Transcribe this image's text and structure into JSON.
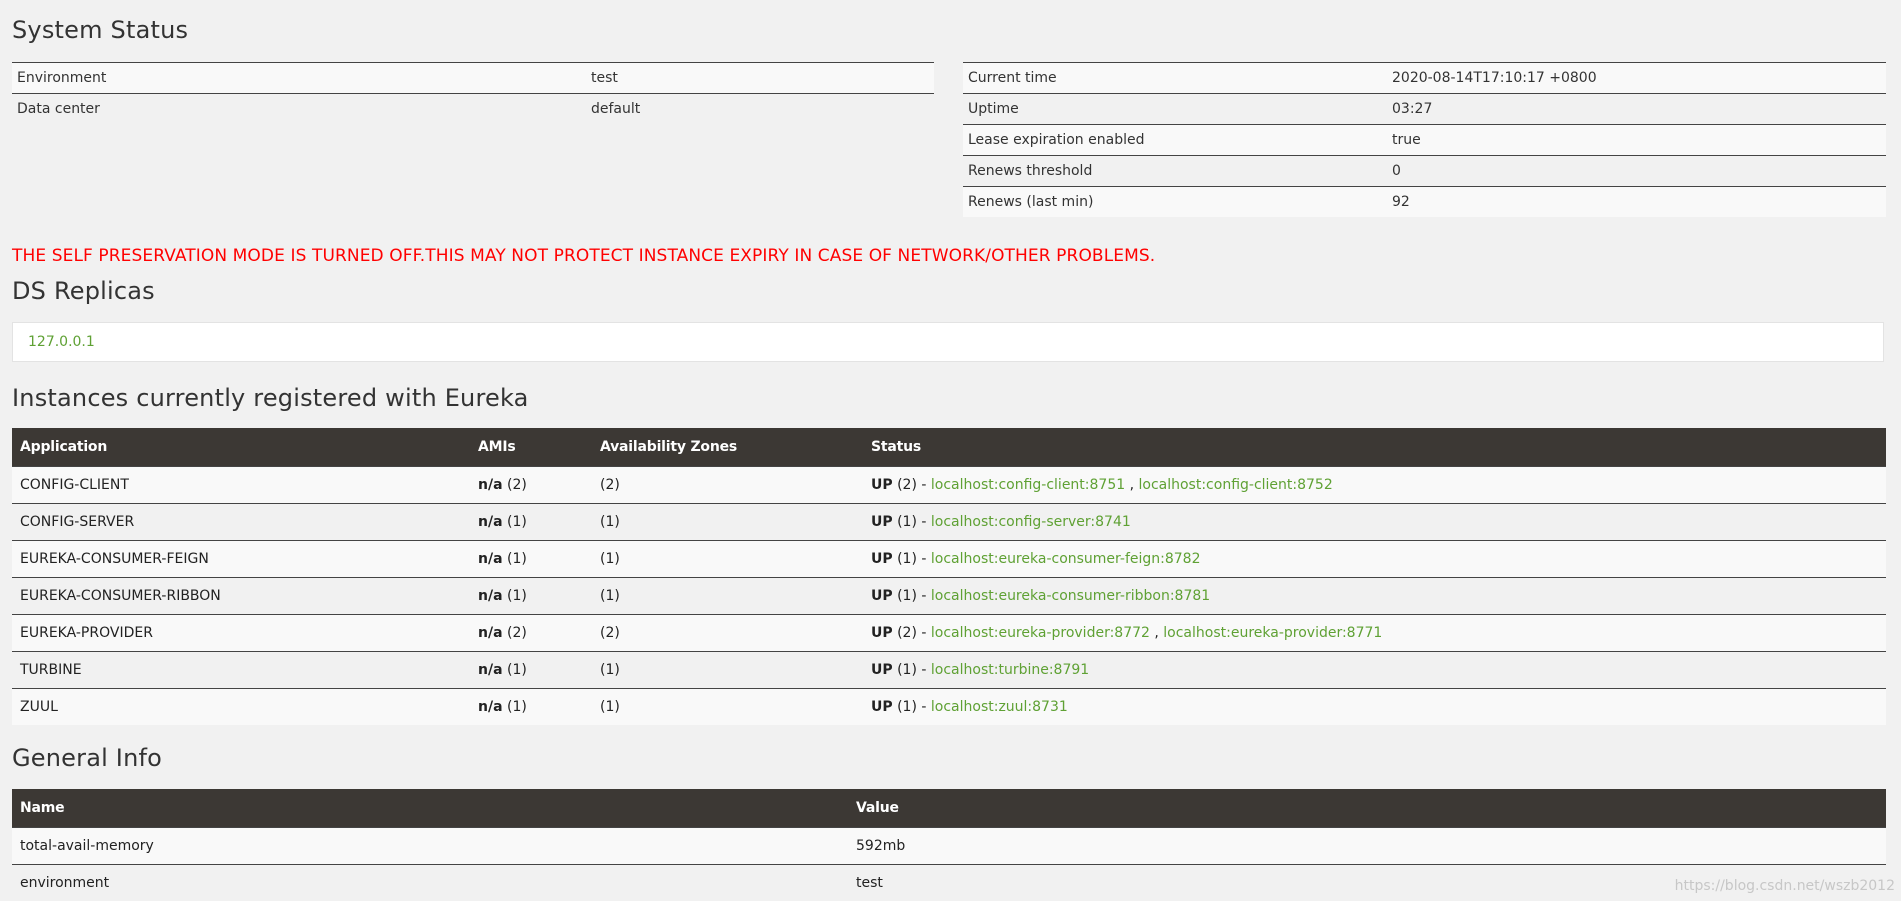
{
  "system_status": {
    "title": "System Status",
    "left": [
      {
        "key": "Environment",
        "value": "test"
      },
      {
        "key": "Data center",
        "value": "default"
      }
    ],
    "right": [
      {
        "key": "Current time",
        "value": "2020-08-14T17:10:17 +0800"
      },
      {
        "key": "Uptime",
        "value": "03:27"
      },
      {
        "key": "Lease expiration enabled",
        "value": "true"
      },
      {
        "key": "Renews threshold",
        "value": "0"
      },
      {
        "key": "Renews (last min)",
        "value": "92"
      }
    ]
  },
  "warning": "THE SELF PRESERVATION MODE IS TURNED OFF.THIS MAY NOT PROTECT INSTANCE EXPIRY IN CASE OF NETWORK/OTHER PROBLEMS.",
  "ds_replicas": {
    "title": "DS Replicas",
    "replica": "127.0.0.1"
  },
  "instances": {
    "title": "Instances currently registered with Eureka",
    "headers": [
      "Application",
      "AMIs",
      "Availability Zones",
      "Status"
    ],
    "rows": [
      {
        "app": "CONFIG-CLIENT",
        "ami": "n/a",
        "ami_count": "(2)",
        "zones": "(2)",
        "status": "UP",
        "status_count": "(2) -",
        "links": [
          "localhost:config-client:8751",
          "localhost:config-client:8752"
        ]
      },
      {
        "app": "CONFIG-SERVER",
        "ami": "n/a",
        "ami_count": "(1)",
        "zones": "(1)",
        "status": "UP",
        "status_count": "(1) -",
        "links": [
          "localhost:config-server:8741"
        ]
      },
      {
        "app": "EUREKA-CONSUMER-FEIGN",
        "ami": "n/a",
        "ami_count": "(1)",
        "zones": "(1)",
        "status": "UP",
        "status_count": "(1) -",
        "links": [
          "localhost:eureka-consumer-feign:8782"
        ]
      },
      {
        "app": "EUREKA-CONSUMER-RIBBON",
        "ami": "n/a",
        "ami_count": "(1)",
        "zones": "(1)",
        "status": "UP",
        "status_count": "(1) -",
        "links": [
          "localhost:eureka-consumer-ribbon:8781"
        ]
      },
      {
        "app": "EUREKA-PROVIDER",
        "ami": "n/a",
        "ami_count": "(2)",
        "zones": "(2)",
        "status": "UP",
        "status_count": "(2) -",
        "links": [
          "localhost:eureka-provider:8772",
          "localhost:eureka-provider:8771"
        ]
      },
      {
        "app": "TURBINE",
        "ami": "n/a",
        "ami_count": "(1)",
        "zones": "(1)",
        "status": "UP",
        "status_count": "(1) -",
        "links": [
          "localhost:turbine:8791"
        ]
      },
      {
        "app": "ZUUL",
        "ami": "n/a",
        "ami_count": "(1)",
        "zones": "(1)",
        "status": "UP",
        "status_count": "(1) -",
        "links": [
          "localhost:zuul:8731"
        ]
      }
    ]
  },
  "general_info": {
    "title": "General Info",
    "headers": [
      "Name",
      "Value"
    ],
    "rows": [
      {
        "name": "total-avail-memory",
        "value": "592mb"
      },
      {
        "name": "environment",
        "value": "test"
      }
    ]
  },
  "watermark": "https://blog.csdn.net/wszb2012",
  "colors": {
    "background": "#f1f1f1",
    "header_bar": "#3c3834",
    "link_green": "#5fa134",
    "warning_red": "#ff0000"
  }
}
